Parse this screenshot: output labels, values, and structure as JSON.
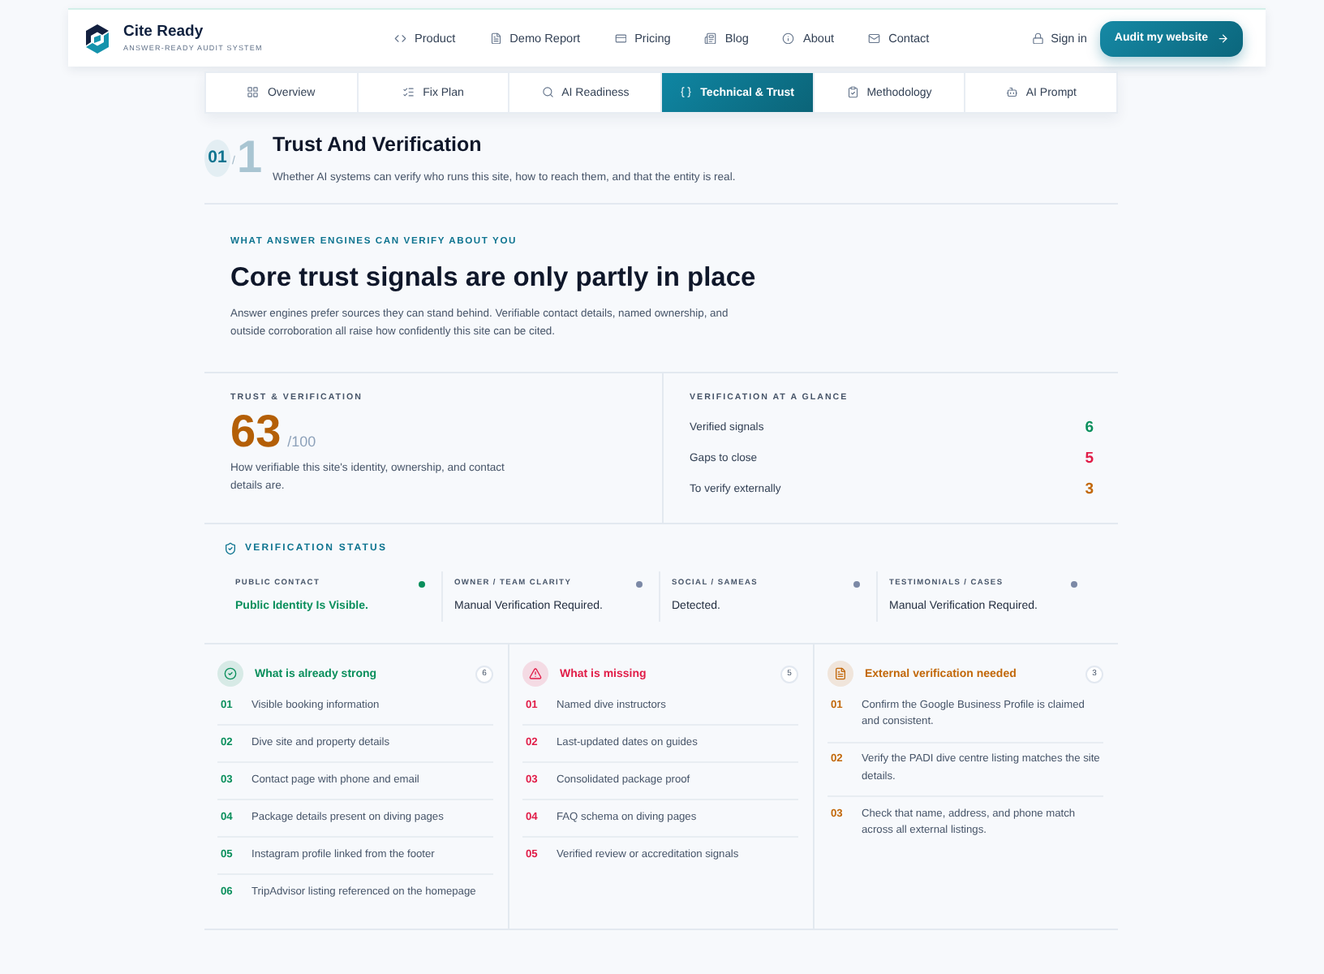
{
  "header": {
    "brand": "Cite Ready",
    "tagline": "ANSWER-READY AUDIT SYSTEM",
    "nav": [
      "Product",
      "Demo Report",
      "Pricing",
      "Blog",
      "About",
      "Contact"
    ],
    "sign_in": "Sign in",
    "cta": "Audit my website"
  },
  "tabs": [
    {
      "label": "Overview",
      "selected": false
    },
    {
      "label": "Fix Plan",
      "selected": false
    },
    {
      "label": "AI Readiness",
      "selected": false
    },
    {
      "label": "Technical & Trust",
      "selected": true
    },
    {
      "label": "Methodology",
      "selected": false
    },
    {
      "label": "AI Prompt",
      "selected": false
    }
  ],
  "section": {
    "index": "01",
    "separator": "/",
    "index_backdrop": "1",
    "title": "Trust And Verification",
    "subtitle": "Whether AI systems can verify who runs this site, how to reach them, and that the entity is real."
  },
  "summary": {
    "kicker": "WHAT ANSWER ENGINES CAN VERIFY ABOUT YOU",
    "headline": "Core trust signals are only partly in place",
    "body": "Answer engines prefer sources they can stand behind. Verifiable contact details, named ownership, and outside corroboration all raise how confidently this site can be cited."
  },
  "score": {
    "label": "TRUST & VERIFICATION",
    "value": "63",
    "max": "/100",
    "description": "How verifiable this site's identity, ownership, and contact details are."
  },
  "glance": {
    "title": "VERIFICATION AT A GLANCE",
    "rows": [
      {
        "label": "Verified signals",
        "value": "6",
        "color": "#0a8f5c"
      },
      {
        "label": "Gaps to close",
        "value": "5",
        "color": "#e11d48"
      },
      {
        "label": "To verify externally",
        "value": "3",
        "color": "#c2680a"
      }
    ]
  },
  "status": {
    "title": "VERIFICATION STATUS",
    "items": [
      {
        "label": "PUBLIC CONTACT",
        "value": "Public Identity Is Visible.",
        "verified": true,
        "color": "#0a8f5c"
      },
      {
        "label": "OWNER / TEAM CLARITY",
        "value": "Manual Verification Required.",
        "verified": false,
        "color": "#7c89a6"
      },
      {
        "label": "SOCIAL / SAMEAS",
        "value": "Detected.",
        "verified": false,
        "color": "#7c89a6"
      },
      {
        "label": "TESTIMONIALS / CASES",
        "value": "Manual Verification Required.",
        "verified": false,
        "color": "#7c89a6"
      }
    ]
  },
  "columns": [
    {
      "kind": "strong",
      "title": "What is already strong",
      "count": "6",
      "color": "#0a8f5c",
      "items": [
        {
          "number": "01",
          "text": "Visible booking information"
        },
        {
          "number": "02",
          "text": "Dive site and property details"
        },
        {
          "number": "03",
          "text": "Contact page with phone and email"
        },
        {
          "number": "04",
          "text": "Package details present on diving pages"
        },
        {
          "number": "05",
          "text": "Instagram profile linked from the footer"
        },
        {
          "number": "06",
          "text": "TripAdvisor listing referenced on the homepage"
        }
      ]
    },
    {
      "kind": "missing",
      "title": "What is missing",
      "count": "5",
      "color": "#e11d48",
      "items": [
        {
          "number": "01",
          "text": "Named dive instructors"
        },
        {
          "number": "02",
          "text": "Last-updated dates on guides"
        },
        {
          "number": "03",
          "text": "Consolidated package proof"
        },
        {
          "number": "04",
          "text": "FAQ schema on diving pages"
        },
        {
          "number": "05",
          "text": "Verified review or accreditation signals"
        }
      ]
    },
    {
      "kind": "external",
      "title": "External verification needed",
      "count": "3",
      "color": "#c2680a",
      "items": [
        {
          "number": "01",
          "text": "Confirm the Google Business Profile is claimed and consistent."
        },
        {
          "number": "02",
          "text": "Verify the PADI dive centre listing matches the site details."
        },
        {
          "number": "03",
          "text": "Check that name, address, and phone match across all external listings."
        }
      ]
    }
  ]
}
